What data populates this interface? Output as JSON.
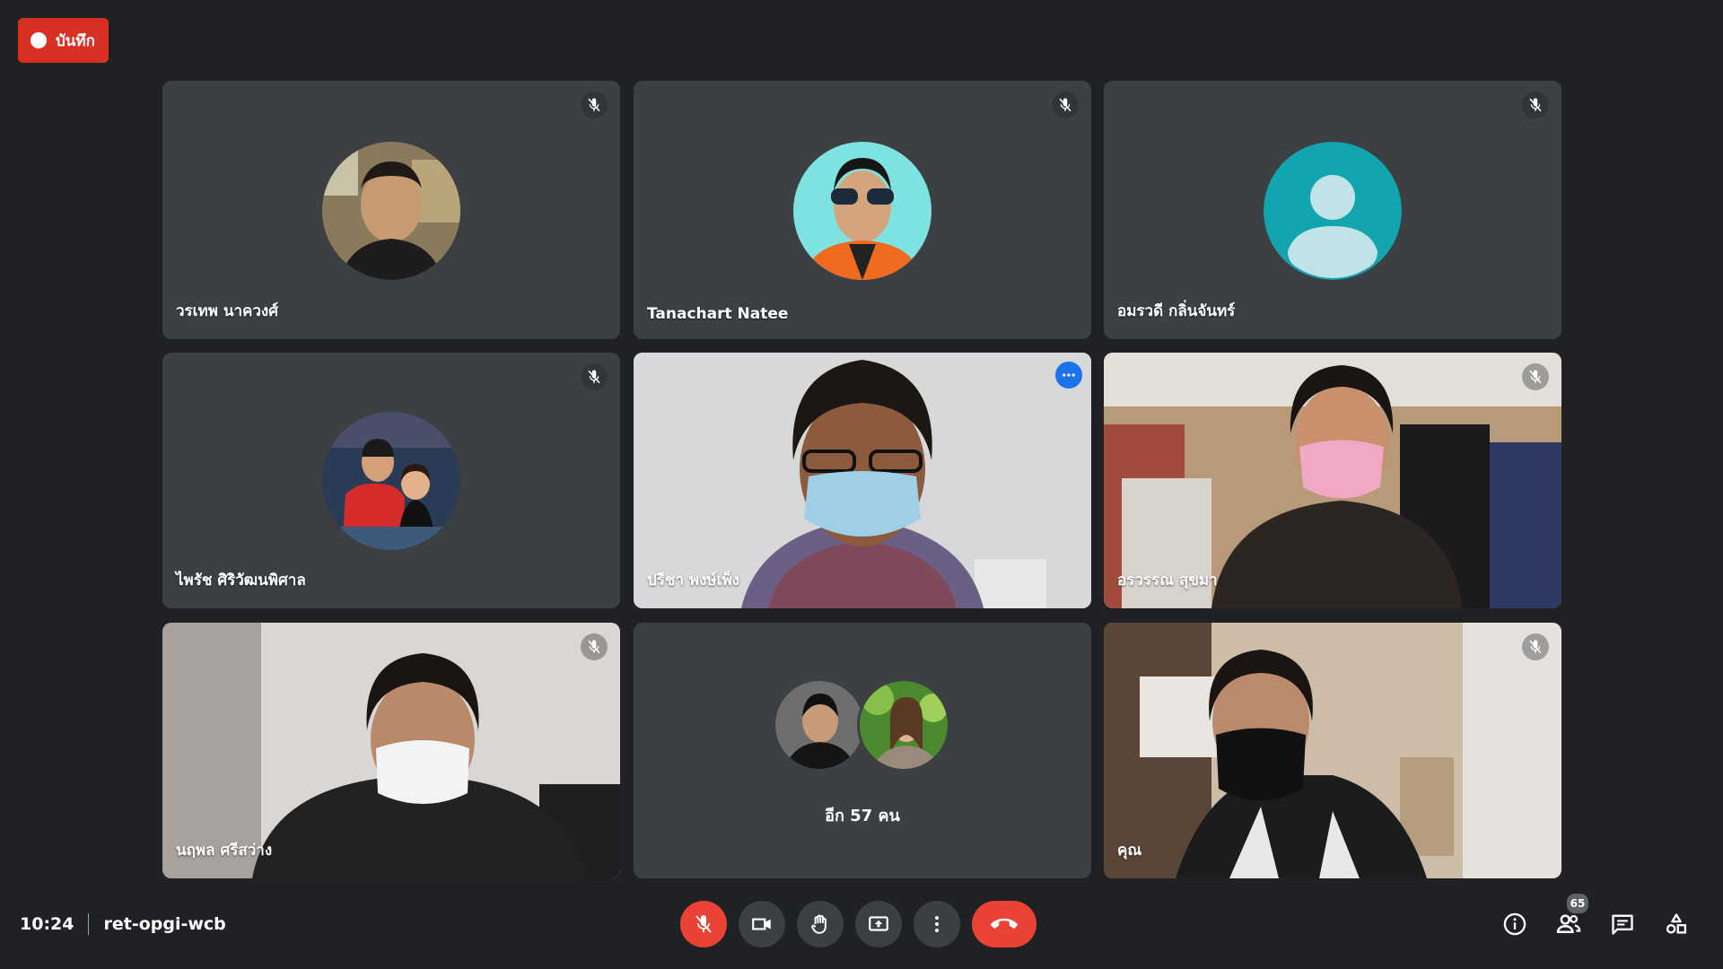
{
  "recording": {
    "label": "บันทึก"
  },
  "meeting": {
    "time": "10:24",
    "code": "ret-opgi-wcb"
  },
  "tiles": [
    {
      "name": "วรเทพ นาควงศ์",
      "kind": "avatar",
      "muted": true
    },
    {
      "name": "Tanachart Natee",
      "kind": "avatar",
      "muted": true
    },
    {
      "name": "อมรวดี กลิ่นจันทร์",
      "kind": "default-avatar",
      "muted": true
    },
    {
      "name": "ไพรัช ศิริวัฒนพิศาล",
      "kind": "avatar",
      "muted": true
    },
    {
      "name": "ปรีชา พงษ์เพ็ง",
      "kind": "video",
      "muted": false,
      "active_speaker": true
    },
    {
      "name": "อรวรรณ สุขมา",
      "kind": "video",
      "muted": true
    },
    {
      "name": "นฤพล ศรีสว่าง",
      "kind": "video",
      "muted": true
    },
    {
      "name": "others",
      "kind": "others",
      "label": "อีก 57 คน"
    },
    {
      "name": "คุณ",
      "kind": "video",
      "muted": true
    }
  ],
  "controls": {
    "mic": "mic-off-icon",
    "camera": "camera-icon",
    "hand": "raise-hand-icon",
    "present": "present-screen-icon",
    "more": "more-vert-icon",
    "end": "end-call-icon"
  },
  "right_panel": {
    "info": "info-icon",
    "people": "people-icon",
    "people_count": "65",
    "chat": "chat-icon",
    "activities": "activities-icon"
  },
  "colors": {
    "background": "#202124",
    "tile": "#3c4043",
    "danger": "#ea4335",
    "active_border": "#8ab4f8",
    "accent": "#1a73e8",
    "default_avatar": "#12a4af"
  }
}
